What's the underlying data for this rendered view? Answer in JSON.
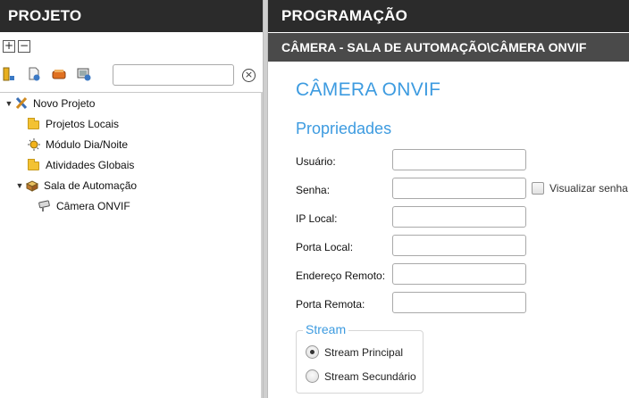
{
  "left_panel": {
    "title": "PROJETO",
    "expand_all": "+",
    "collapse_all": "−",
    "filter_placeholder": "",
    "clear_symbol": "×",
    "tree": [
      {
        "label": "Novo Projeto",
        "icon": "project-tools-icon",
        "level": 0,
        "expanded": true
      },
      {
        "label": "Projetos Locais",
        "icon": "folder-icon",
        "level": 1
      },
      {
        "label": "Módulo Dia/Noite",
        "icon": "sun-moon-icon",
        "level": 1
      },
      {
        "label": "Atividades Globais",
        "icon": "folder-icon",
        "level": 1
      },
      {
        "label": "Sala de Automação",
        "icon": "room-box-icon",
        "level": 1,
        "expanded": true
      },
      {
        "label": "Câmera ONVIF",
        "icon": "camera-icon",
        "level": 2
      }
    ],
    "toolbar_icons": [
      "add-device-icon",
      "add-module-icon",
      "add-activity-icon",
      "add-camera-icon"
    ]
  },
  "right_panel": {
    "title": "PROGRAMAÇÃO",
    "breadcrumb": "CÂMERA - SALA DE AUTOMAÇÃO\\CÂMERA ONVIF",
    "device_title": "CÂMERA ONVIF",
    "section": "Propriedades",
    "fields": {
      "usuario": {
        "label": "Usuário:",
        "value": ""
      },
      "senha": {
        "label": "Senha:",
        "value": ""
      },
      "ip_local": {
        "label": "IP Local:",
        "value": ""
      },
      "porta_local": {
        "label": "Porta Local:",
        "value": ""
      },
      "endereco_remoto": {
        "label": "Endereço Remoto:",
        "value": ""
      },
      "porta_remota": {
        "label": "Porta Remota:",
        "value": ""
      }
    },
    "show_password": {
      "label": "Visualizar senha",
      "checked": false
    },
    "stream": {
      "legend": "Stream",
      "principal": "Stream Principal",
      "secundario": "Stream Secundário",
      "selected": "principal"
    }
  },
  "colors": {
    "header_bg": "#2b2b2b",
    "subheader_bg": "#4a4a4a",
    "accent": "#3d9be0"
  }
}
